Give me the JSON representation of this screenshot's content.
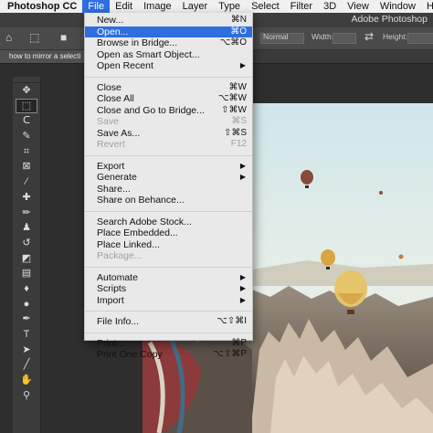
{
  "menubar": {
    "apple_icon": "apple-logo-icon",
    "app_name": "Photoshop CC",
    "items": [
      "File",
      "Edit",
      "Image",
      "Layer",
      "Type",
      "Select",
      "Filter",
      "3D",
      "View",
      "Window",
      "Help"
    ]
  },
  "window": {
    "title": "Adobe Photoshop"
  },
  "options_bar": {
    "mode_value": "Normal",
    "width_label": "Width:",
    "height_label": "Height:"
  },
  "document_tab": {
    "title": "how to mirror a selecti"
  },
  "file_menu": {
    "groups": [
      [
        {
          "label": "New...",
          "shortcut": "⌘N"
        },
        {
          "label": "Open...",
          "shortcut": "⌘O",
          "highlighted": true
        },
        {
          "label": "Browse in Bridge...",
          "shortcut": "⌥⌘O"
        },
        {
          "label": "Open as Smart Object...",
          "shortcut": ""
        },
        {
          "label": "Open Recent",
          "shortcut": "",
          "submenu": true
        }
      ],
      [
        {
          "label": "Close",
          "shortcut": "⌘W"
        },
        {
          "label": "Close All",
          "shortcut": "⌥⌘W"
        },
        {
          "label": "Close and Go to Bridge...",
          "shortcut": "⇧⌘W"
        },
        {
          "label": "Save",
          "shortcut": "⌘S",
          "disabled": true
        },
        {
          "label": "Save As...",
          "shortcut": "⇧⌘S"
        },
        {
          "label": "Revert",
          "shortcut": "F12",
          "disabled": true
        }
      ],
      [
        {
          "label": "Export",
          "shortcut": "",
          "submenu": true
        },
        {
          "label": "Generate",
          "shortcut": "",
          "submenu": true
        },
        {
          "label": "Share...",
          "shortcut": ""
        },
        {
          "label": "Share on Behance...",
          "shortcut": ""
        }
      ],
      [
        {
          "label": "Search Adobe Stock...",
          "shortcut": ""
        },
        {
          "label": "Place Embedded...",
          "shortcut": ""
        },
        {
          "label": "Place Linked...",
          "shortcut": ""
        },
        {
          "label": "Package...",
          "shortcut": "",
          "disabled": true
        }
      ],
      [
        {
          "label": "Automate",
          "shortcut": "",
          "submenu": true
        },
        {
          "label": "Scripts",
          "shortcut": "",
          "submenu": true
        },
        {
          "label": "Import",
          "shortcut": "",
          "submenu": true
        }
      ],
      [
        {
          "label": "File Info...",
          "shortcut": "⌥⇧⌘I"
        }
      ],
      [
        {
          "label": "Print...",
          "shortcut": "⌘P"
        },
        {
          "label": "Print One Copy",
          "shortcut": "⌥⇧⌘P"
        }
      ]
    ]
  },
  "toolbar": {
    "tools": [
      {
        "name": "move-tool-icon",
        "glyph": "✥"
      },
      {
        "name": "marquee-tool-icon",
        "glyph": "⬚",
        "selected": true
      },
      {
        "name": "lasso-tool-icon",
        "glyph": "ᑕ"
      },
      {
        "name": "quick-selection-tool-icon",
        "glyph": "✎"
      },
      {
        "name": "crop-tool-icon",
        "glyph": "⌗"
      },
      {
        "name": "frame-tool-icon",
        "glyph": "⊠"
      },
      {
        "name": "eyedropper-tool-icon",
        "glyph": "⁄"
      },
      {
        "name": "healing-brush-tool-icon",
        "glyph": "✚"
      },
      {
        "name": "brush-tool-icon",
        "glyph": "✏"
      },
      {
        "name": "clone-stamp-tool-icon",
        "glyph": "♟"
      },
      {
        "name": "history-brush-tool-icon",
        "glyph": "↺"
      },
      {
        "name": "eraser-tool-icon",
        "glyph": "◩"
      },
      {
        "name": "gradient-tool-icon",
        "glyph": "▤"
      },
      {
        "name": "blur-tool-icon",
        "glyph": "♦"
      },
      {
        "name": "dodge-tool-icon",
        "glyph": "●"
      },
      {
        "name": "pen-tool-icon",
        "glyph": "✒"
      },
      {
        "name": "type-tool-icon",
        "glyph": "T"
      },
      {
        "name": "path-selection-tool-icon",
        "glyph": "➤"
      },
      {
        "name": "line-tool-icon",
        "glyph": "╱"
      },
      {
        "name": "hand-tool-icon",
        "glyph": "✋"
      },
      {
        "name": "zoom-tool-icon",
        "glyph": "⚲"
      }
    ]
  }
}
